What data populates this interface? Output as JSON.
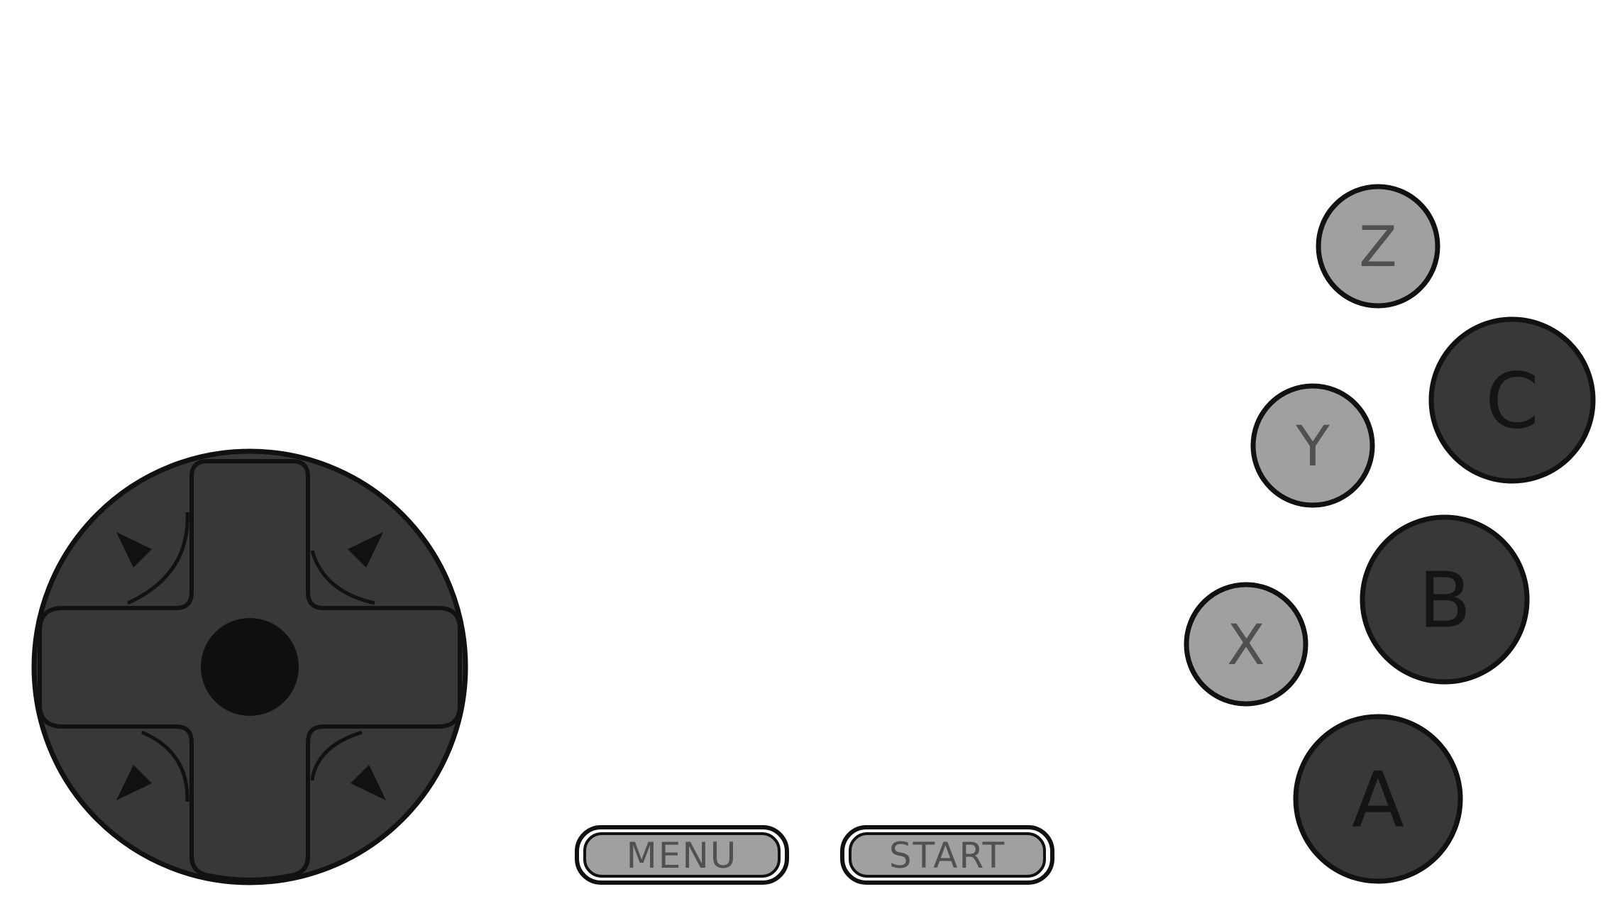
{
  "theme": {
    "dark": "#383838",
    "light": "#a0a0a0",
    "outline": "#111111",
    "dark_label": "#141414",
    "light_label": "#505050"
  },
  "buttons": {
    "z": "Z",
    "c": "C",
    "y": "Y",
    "b": "B",
    "x": "X",
    "a": "A"
  },
  "system": {
    "menu": "MENU",
    "start": "START"
  },
  "icons": {
    "dpad": "dpad-icon",
    "stick": "analog-stick-icon",
    "diagonal_arrows": [
      "arrow-up-left-icon",
      "arrow-up-right-icon",
      "arrow-down-left-icon",
      "arrow-down-right-icon"
    ]
  }
}
